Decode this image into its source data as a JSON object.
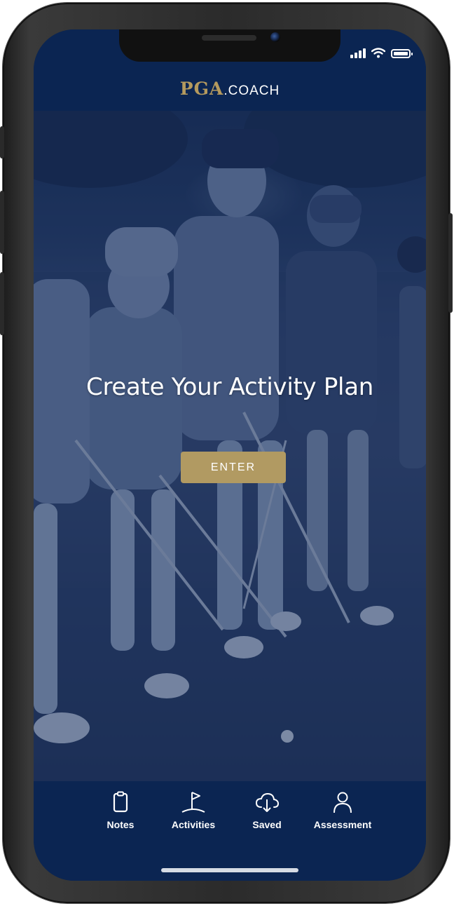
{
  "header": {
    "logo_pga": "PGA",
    "logo_coach": ".COACH"
  },
  "hero": {
    "title": "Create Your Activity Plan",
    "enter_label": "ENTER"
  },
  "tabs": [
    {
      "label": "Notes",
      "icon": "clipboard-icon"
    },
    {
      "label": "Activities",
      "icon": "flag-icon"
    },
    {
      "label": "Saved",
      "icon": "cloud-download-icon"
    },
    {
      "label": "Assessment",
      "icon": "person-icon"
    }
  ],
  "status_bar": {
    "icons": [
      "signal-icon",
      "wifi-icon",
      "battery-icon"
    ]
  },
  "colors": {
    "navy": "#0b2552",
    "gold": "#b19a62",
    "white": "#ffffff"
  }
}
